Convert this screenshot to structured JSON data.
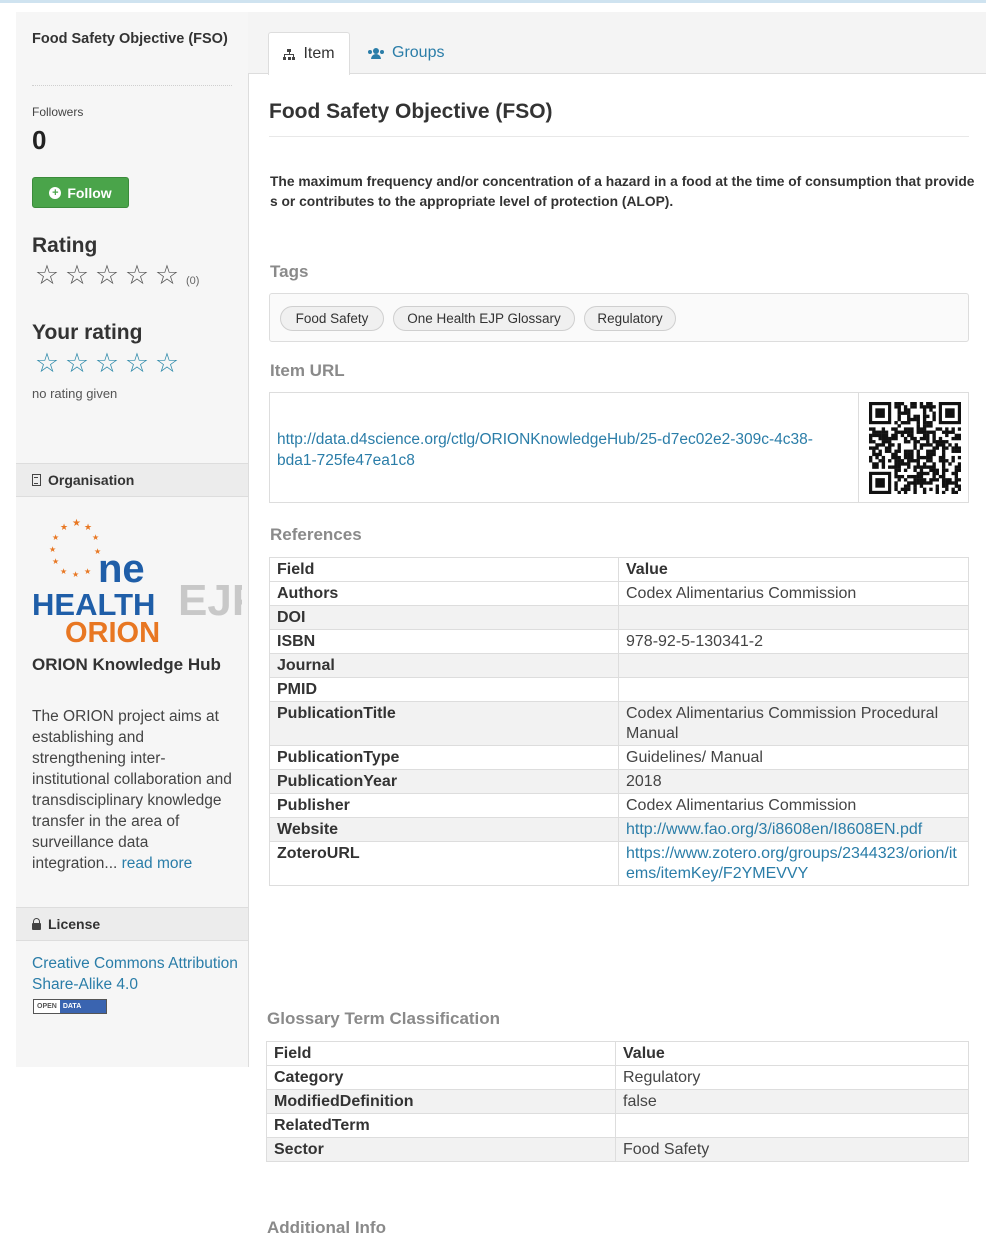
{
  "sidebar": {
    "title": "Food Safety Objective (FSO)",
    "followers_label": "Followers",
    "followers_count": "0",
    "follow_label": "Follow",
    "rating_heading": "Rating",
    "rating_count": "(0)",
    "rating_stars": 0,
    "your_rating_heading": "Your rating",
    "your_rating_stars": 0,
    "no_rating_text": "no rating given",
    "organisation_heading": "Organisation",
    "org_logo_text": [
      "ne",
      "HEALTH",
      "EJP",
      "ORION"
    ],
    "org_name": "ORION Knowledge Hub",
    "org_description": "The ORION project aims at establishing and strengthening inter-institutional collaboration and transdisciplinary knowledge transfer in the area of surveillance data integration...",
    "read_more": "read more",
    "license_heading": "License",
    "license_link": "Creative Commons Attribution Share-Alike 4.0",
    "open_data_badge": [
      "OPEN",
      "DATA"
    ]
  },
  "tabs": [
    {
      "label": "Item",
      "icon": "sitemap-icon",
      "active": true
    },
    {
      "label": "Groups",
      "icon": "users-icon",
      "active": false
    }
  ],
  "item": {
    "title": "Food Safety Objective (FSO)",
    "description": "The maximum frequency and/or concentration of a hazard in a food at the time of consumption that provides or contributes to the appropriate level of protection (ALOP).",
    "tags_heading": "Tags",
    "tags": [
      "Food Safety",
      "One Health EJP Glossary",
      "Regulatory"
    ],
    "url_heading": "Item URL",
    "url": "http://data.d4science.org/ctlg/ORIONKnowledgeHub/25-d7ec02e2-309c-4c38-bda1-725fe47ea1c8",
    "references_heading": "References",
    "references": {
      "header": [
        "Field",
        "Value"
      ],
      "rows": [
        [
          "Authors",
          "Codex Alimentarius Commission"
        ],
        [
          "DOI",
          ""
        ],
        [
          "ISBN",
          "978-92-5-130341-2"
        ],
        [
          "Journal",
          ""
        ],
        [
          "PMID",
          ""
        ],
        [
          "PublicationTitle",
          "Codex Alimentarius Commission Procedural Manual"
        ],
        [
          "PublicationType",
          "Guidelines/ Manual"
        ],
        [
          "PublicationYear",
          "2018"
        ],
        [
          "Publisher",
          "Codex Alimentarius Commission"
        ],
        [
          "Website",
          "http://www.fao.org/3/i8608en/I8608EN.pdf"
        ],
        [
          "ZoteroURL",
          "https://www.zotero.org/groups/2344323/orion/items/itemKey/F2YMEVVY"
        ]
      ]
    },
    "glossary_heading": "Glossary Term Classification",
    "glossary": {
      "header": [
        "Field",
        "Value"
      ],
      "rows": [
        [
          "Category",
          "Regulatory"
        ],
        [
          "ModifiedDefinition",
          "false"
        ],
        [
          "RelatedTerm",
          ""
        ],
        [
          "Sector",
          "Food Safety"
        ]
      ]
    },
    "additional_heading": "Additional Info"
  },
  "colors": {
    "link": "#2a7da8",
    "follow_button": "#4aa44a",
    "logo_blue": "#1f5ea8",
    "logo_orange": "#e87722"
  }
}
